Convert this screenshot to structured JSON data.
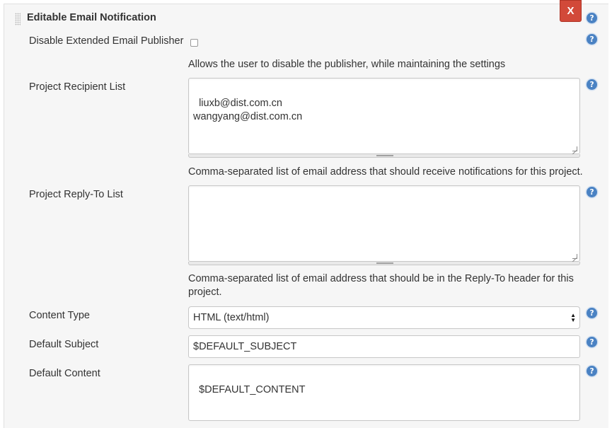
{
  "section": {
    "title": "Editable Email Notification",
    "close_label": "X"
  },
  "help_icon_glyph": "?",
  "disable_publisher": {
    "label": "Disable Extended Email Publisher",
    "checked": false,
    "description": "Allows the user to disable the publisher, while maintaining the settings"
  },
  "recipient_list": {
    "label": "Project Recipient List",
    "value": "liuxb@dist.com.cn\nwangyang@dist.com.cn",
    "description": "Comma-separated list of email address that should receive notifications for this project."
  },
  "reply_to_list": {
    "label": "Project Reply-To List",
    "value": "",
    "description_line1": "Comma-separated list of email address that should be in the Reply-To header for this",
    "description_line2": "project."
  },
  "content_type": {
    "label": "Content Type",
    "selected": "HTML (text/html)"
  },
  "default_subject": {
    "label": "Default Subject",
    "value": "$DEFAULT_SUBJECT"
  },
  "default_content": {
    "label": "Default Content",
    "value": "$DEFAULT_CONTENT"
  },
  "colors": {
    "close_button": "#d24939",
    "help_icon": "#4a82c3",
    "panel_background": "#f6f6f6"
  }
}
